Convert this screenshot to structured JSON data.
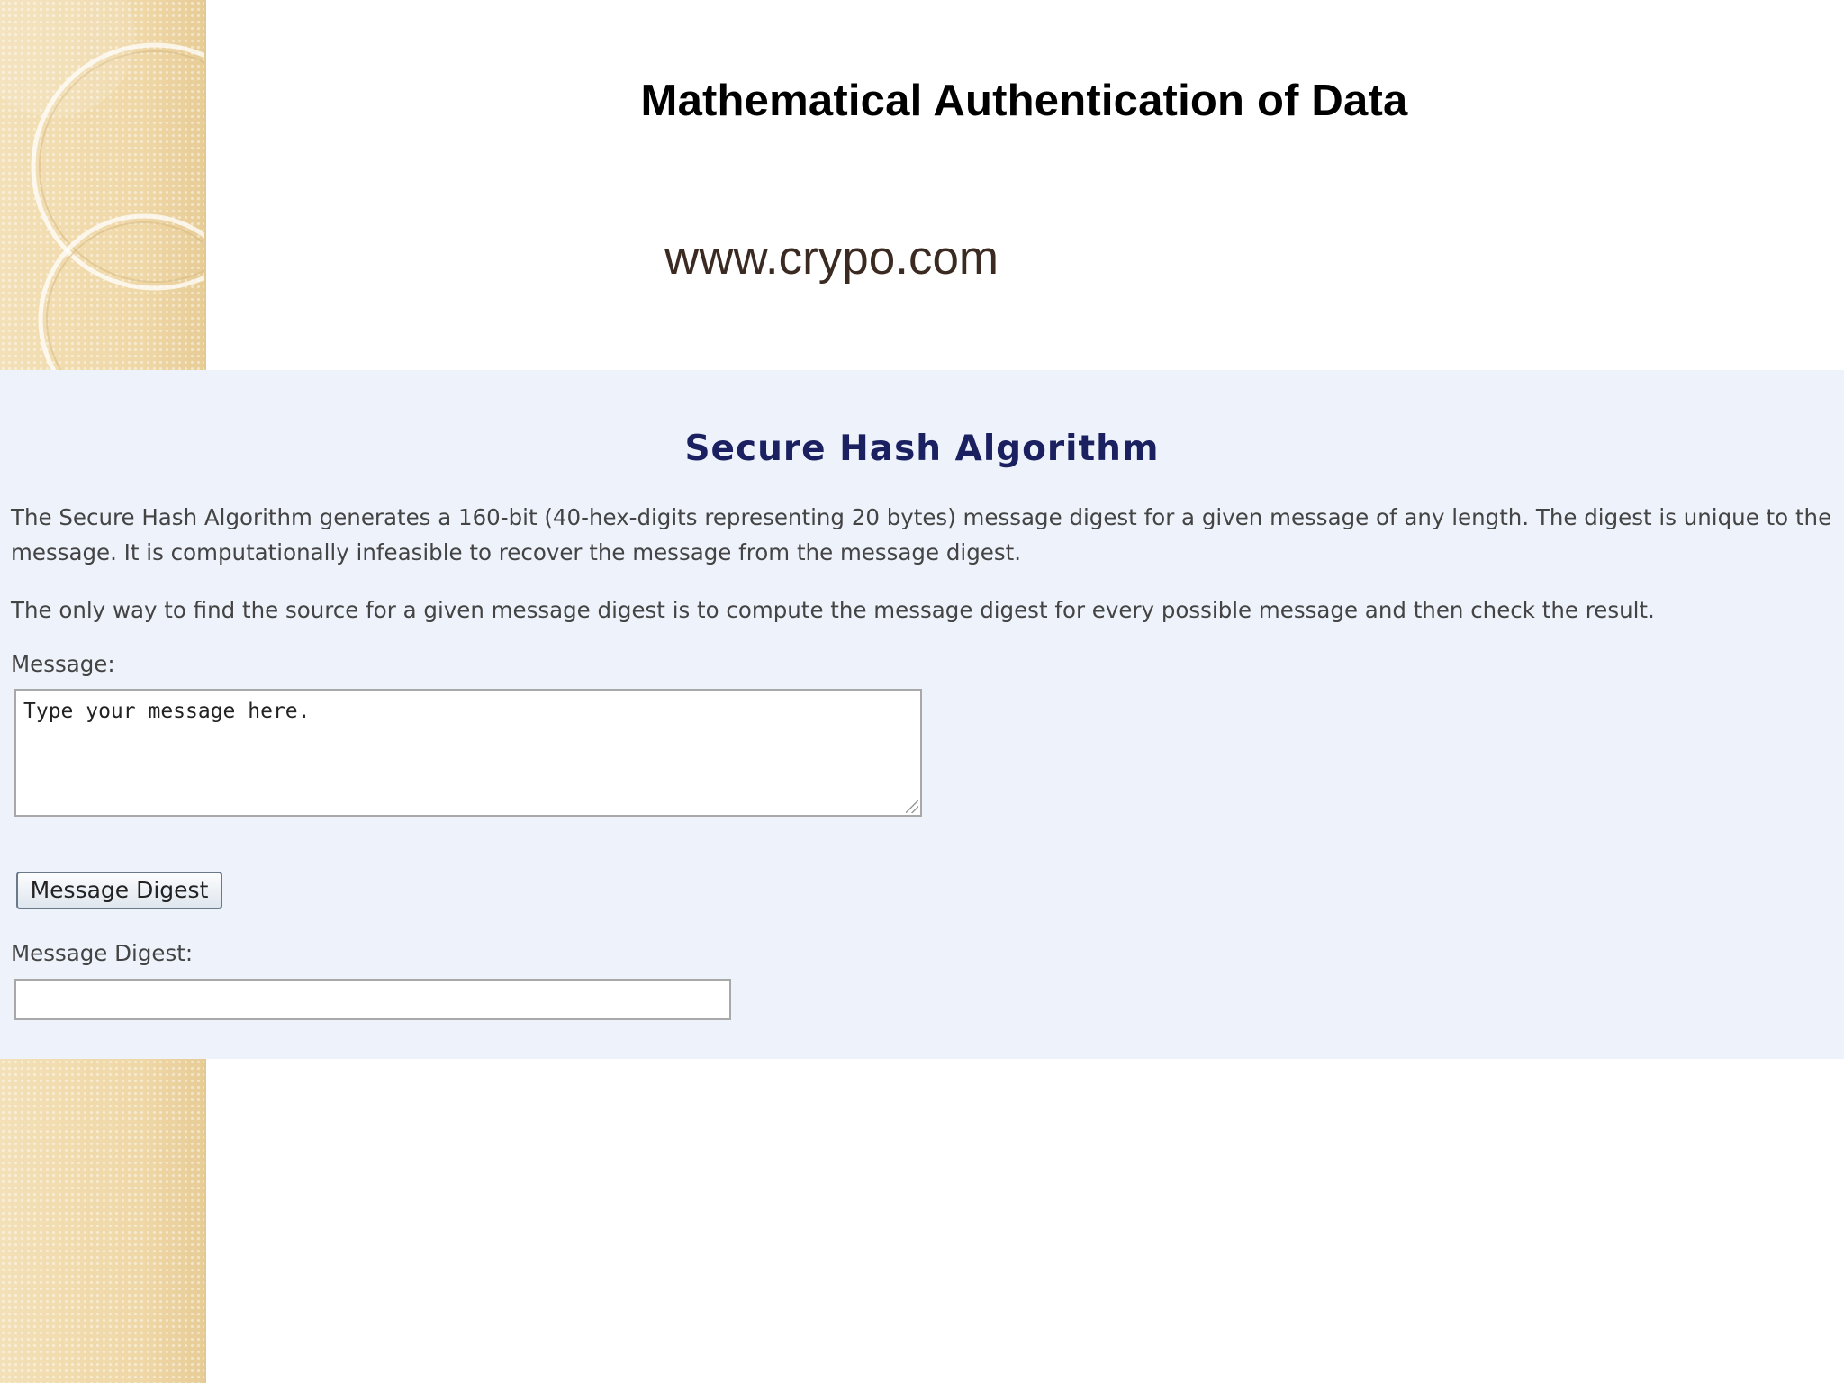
{
  "slide": {
    "title": "Mathematical Authentication of Data",
    "url": "www.crypo.com"
  },
  "sha_page": {
    "heading": "Secure Hash Algorithm",
    "paragraph_1": "The Secure Hash Algorithm generates a 160-bit (40-hex-digits representing 20 bytes) message digest for a given message of any length. The digest is unique to the message. It is computationally infeasible to recover the message from the message digest.",
    "paragraph_2": "The only way to find the source for a given message digest is to compute the message digest for every possible message and then check the result.",
    "message_label": "Message:",
    "message_value": "Type your message here.",
    "digest_button_label": "Message Digest",
    "digest_label": "Message Digest:",
    "digest_value": ""
  },
  "colors": {
    "heading": "#1a2060",
    "panel_background": "#eef3fb",
    "decor_strip": "#f1dcb0"
  }
}
